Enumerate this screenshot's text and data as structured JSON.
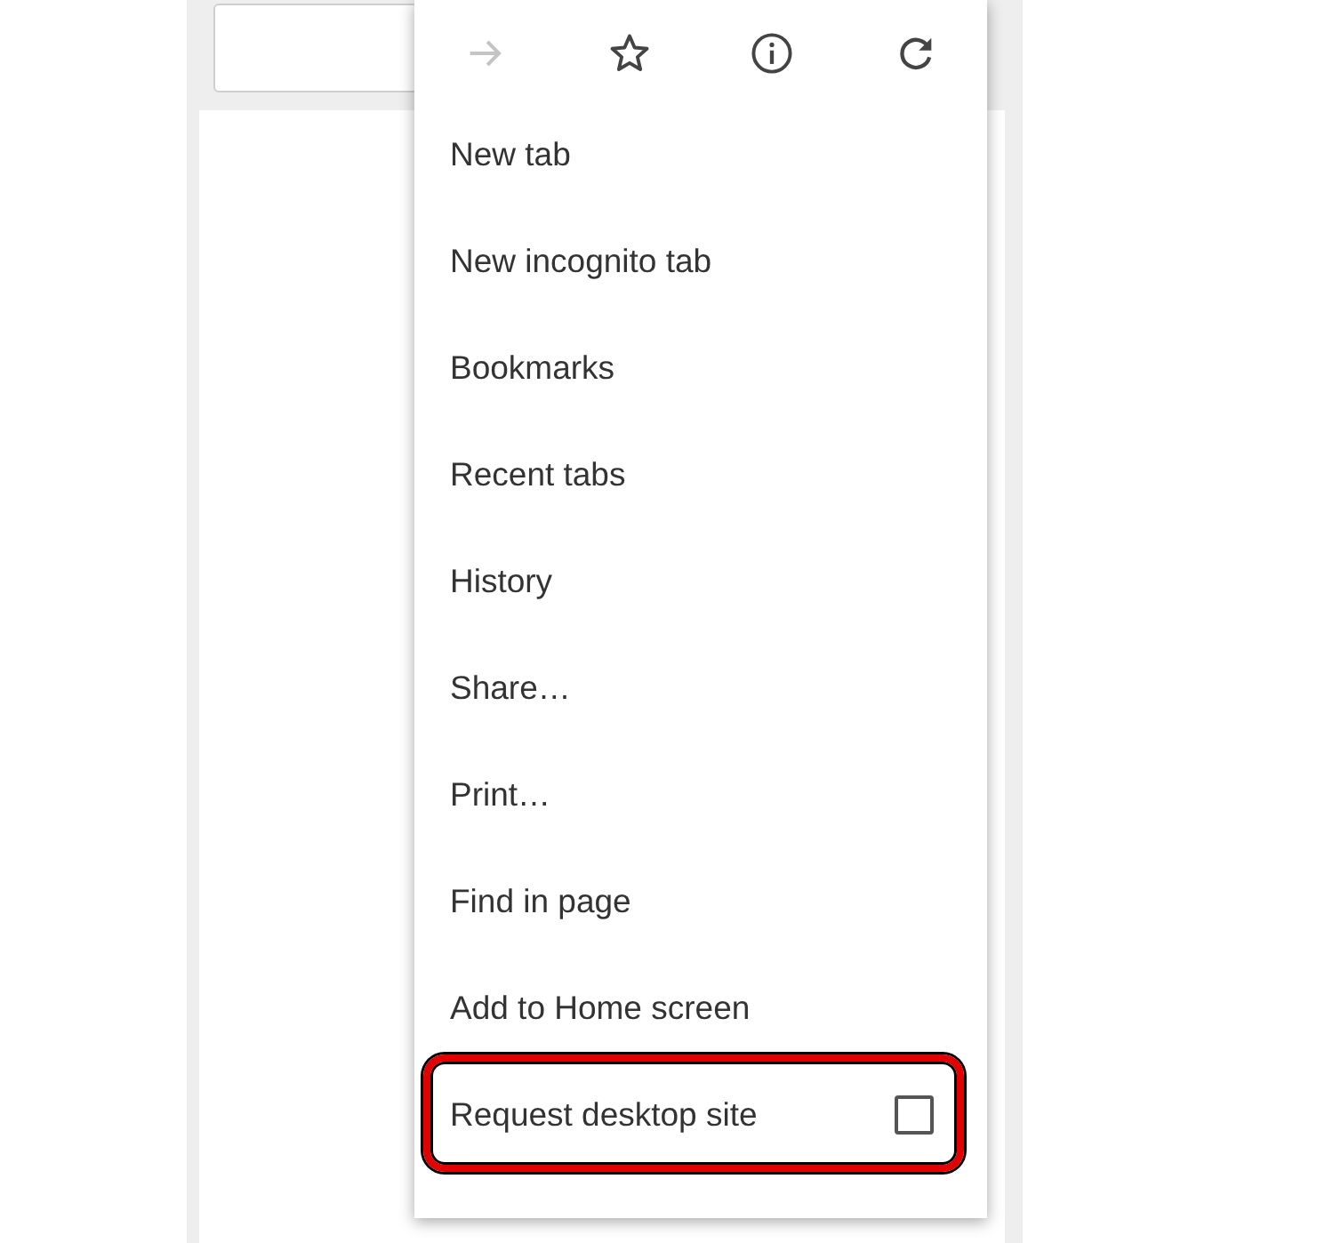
{
  "toolbar": [
    {
      "kind": "forward",
      "disabled": true
    },
    {
      "kind": "bookmark",
      "disabled": false
    },
    {
      "kind": "info",
      "disabled": false
    },
    {
      "kind": "reload",
      "disabled": false
    }
  ],
  "menu": [
    {
      "kind": "plain",
      "label": "New tab"
    },
    {
      "kind": "plain",
      "label": "New incognito tab"
    },
    {
      "kind": "plain",
      "label": "Bookmarks"
    },
    {
      "kind": "plain",
      "label": "Recent tabs"
    },
    {
      "kind": "plain",
      "label": "History"
    },
    {
      "kind": "plain",
      "label": "Share…"
    },
    {
      "kind": "plain",
      "label": "Print…"
    },
    {
      "kind": "plain",
      "label": "Find in page"
    },
    {
      "kind": "plain",
      "label": "Add to Home screen"
    },
    {
      "kind": "checkbox",
      "label": "Request desktop site",
      "checked": false,
      "highlighted": true
    }
  ]
}
